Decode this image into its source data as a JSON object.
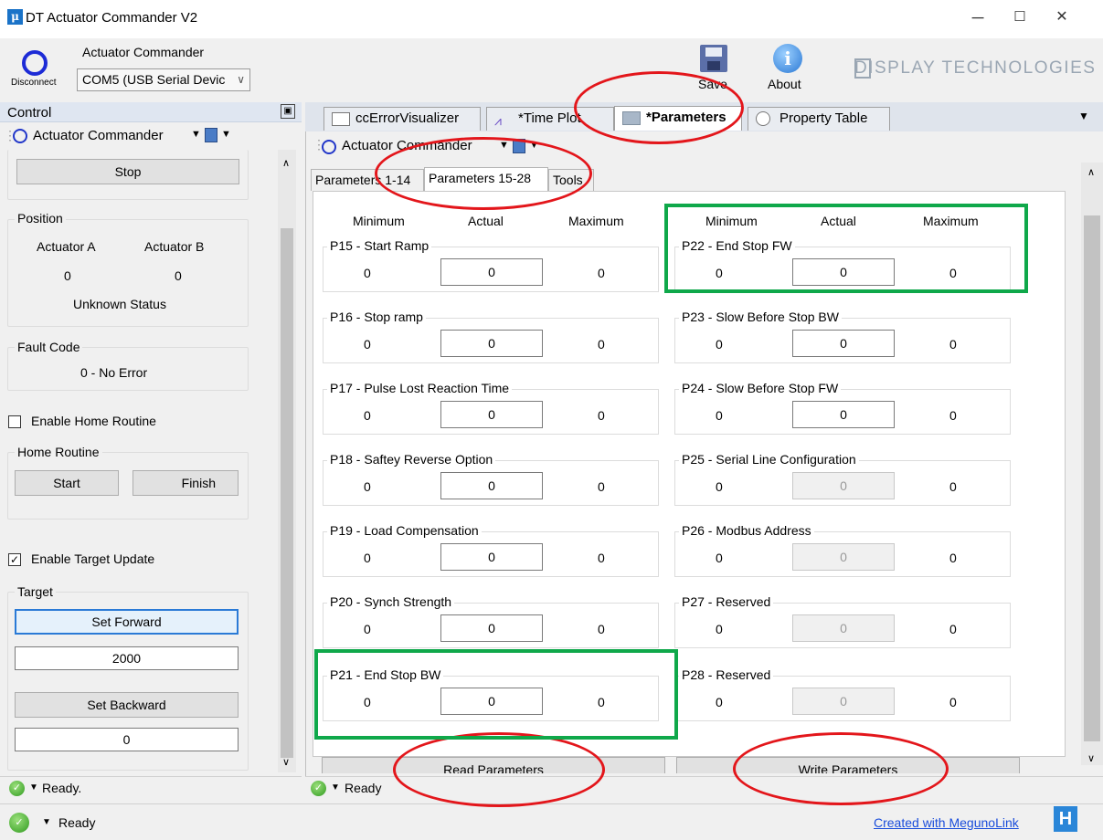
{
  "window": {
    "title": "DT Actuator Commander V2",
    "logo_glyph": "μ",
    "min": "─",
    "max": "☐",
    "close": "✕"
  },
  "toolbar": {
    "disconnect_label": "Disconnect",
    "app_label": "Actuator Commander",
    "port": "COM5 (USB Serial Devic",
    "save_label": "Save",
    "about_label": "About",
    "brand": "DISPLAY TECHNOLOGIES"
  },
  "control": {
    "header": "Control",
    "toolbar_label": "Actuator Commander",
    "stop_label": "Stop",
    "position": {
      "title": "Position",
      "col_a": "Actuator A",
      "col_b": "Actuator B",
      "val_a": "0",
      "val_b": "0",
      "status": "Unknown Status"
    },
    "fault": {
      "title": "Fault Code",
      "value": "0 - No Error"
    },
    "enable_home": {
      "label": "Enable Home Routine",
      "checked": false
    },
    "home": {
      "title": "Home Routine",
      "start": "Start",
      "finish": "Finish"
    },
    "enable_target": {
      "label": "Enable Target Update",
      "checked": true
    },
    "target": {
      "title": "Target",
      "set_forward": "Set Forward",
      "forward_value": "2000",
      "set_backward": "Set Backward",
      "backward_value": "0"
    },
    "status": "Ready."
  },
  "tabs": [
    {
      "label": "ccErrorVisualizer"
    },
    {
      "label": "*Time Plot"
    },
    {
      "label": "*Parameters"
    },
    {
      "label": "Property Table"
    }
  ],
  "parameters": {
    "toolbar_label": "Actuator Commander",
    "subtabs": [
      "Parameters 1-14",
      "Parameters 15-28",
      "Tools"
    ],
    "col_min": "Minimum",
    "col_actual": "Actual",
    "col_max": "Maximum",
    "left": [
      {
        "name": "P15 - Start Ramp",
        "min": "0",
        "actual": "0",
        "max": "0"
      },
      {
        "name": "P16 - Stop ramp",
        "min": "0",
        "actual": "0",
        "max": "0"
      },
      {
        "name": "P17 - Pulse Lost Reaction Time",
        "min": "0",
        "actual": "0",
        "max": "0"
      },
      {
        "name": "P18 - Saftey Reverse Option",
        "min": "0",
        "actual": "0",
        "max": "0"
      },
      {
        "name": "P19 - Load Compensation",
        "min": "0",
        "actual": "0",
        "max": "0"
      },
      {
        "name": "P20 - Synch Strength",
        "min": "0",
        "actual": "0",
        "max": "0"
      },
      {
        "name": "P21 - End Stop BW",
        "min": "0",
        "actual": "0",
        "max": "0"
      }
    ],
    "right": [
      {
        "name": "P22 - End Stop FW",
        "min": "0",
        "actual": "0",
        "max": "0"
      },
      {
        "name": "P23 - Slow Before Stop BW",
        "min": "0",
        "actual": "0",
        "max": "0"
      },
      {
        "name": "P24 - Slow Before Stop FW",
        "min": "0",
        "actual": "0",
        "max": "0"
      },
      {
        "name": "P25 - Serial Line Configuration",
        "min": "0",
        "actual": "0",
        "max": "0"
      },
      {
        "name": "P26 - Modbus Address",
        "min": "0",
        "actual": "0",
        "max": "0"
      },
      {
        "name": "P27 - Reserved",
        "min": "0",
        "actual": "0",
        "max": "0"
      },
      {
        "name": "P28 - Reserved",
        "min": "0",
        "actual": "0",
        "max": "0"
      }
    ],
    "read_label": "Read Parameters",
    "write_label": "Write Parameters",
    "status": "Ready"
  },
  "footer": {
    "status": "Ready",
    "link": "Created with MegunoLink"
  }
}
